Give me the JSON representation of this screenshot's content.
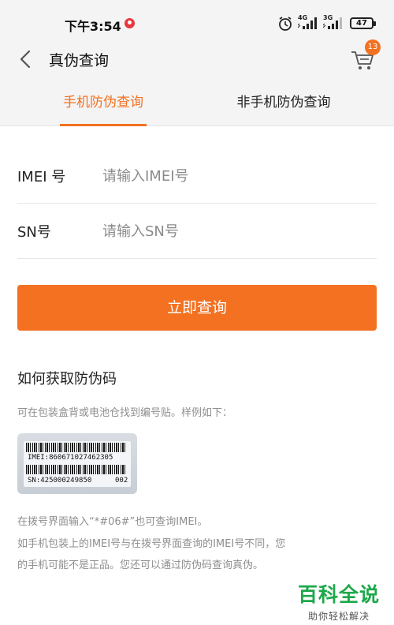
{
  "status_bar": {
    "time": "下午3:54",
    "signal_1_net": "4G",
    "signal_2_net": "3G",
    "battery": "47"
  },
  "header": {
    "title": "真伪查询",
    "cart_count": "13"
  },
  "tabs": [
    {
      "label": "手机防伪查询",
      "active": true
    },
    {
      "label": "非手机防伪查询",
      "active": false
    }
  ],
  "form": {
    "imei_label": "IMEI 号",
    "imei_placeholder": "请输入IMEI号",
    "sn_label": "SN号",
    "sn_placeholder": "请输入SN号",
    "submit_label": "立即查询"
  },
  "help": {
    "title": "如何获取防伪码",
    "description": "可在包装盒背或电池仓找到编号贴。样例如下：",
    "sample_label": {
      "imei_text": "IMEI:860671027462305",
      "sn_text": "SN:425000249850",
      "suffix_text": "002"
    },
    "notes": [
      "在拨号界面输入“*#06#”也可查询IMEI。",
      "如手机包装上的IMEI号与在拨号界面查询的IMEI号不同，您",
      "的手机可能不是正品。您还可以通过防伪码查询真伪。"
    ]
  },
  "watermark": {
    "main": "百科全说",
    "sub": "助你轻松解决"
  },
  "colors": {
    "accent": "#f37121",
    "watermark_green": "#1da84a"
  },
  "icons": [
    "alarm-icon",
    "signal-icon",
    "battery-icon",
    "back-icon",
    "cart-icon"
  ]
}
